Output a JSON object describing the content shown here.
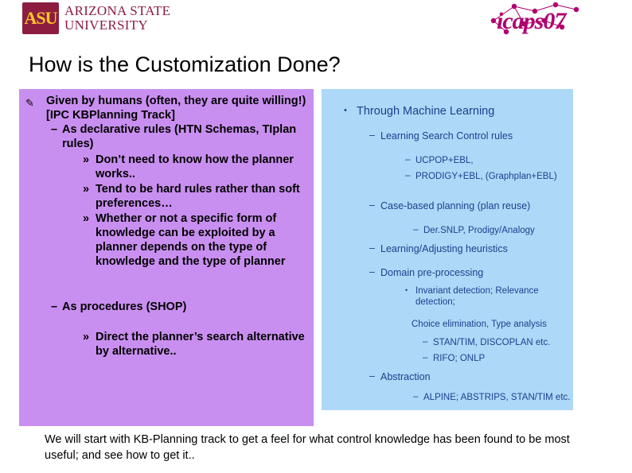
{
  "header": {
    "asu_logo": {
      "mark": "ASU",
      "line1_caps": "RIZONA",
      "line1_first": "A",
      "line1_word2_first": "S",
      "line1_word2_caps": "TATE",
      "line1": "ARIZONA STATE",
      "line2": "UNIVERSITY"
    },
    "icaps_logo_text": "icaps07"
  },
  "title": "How is the Customization Done?",
  "left_panel": {
    "level1": "Given by humans (often, they are quite willing!)[IPC KBPlanning Track]",
    "items": [
      {
        "level": 2,
        "text": "As declarative rules (HTN Schemas, TIplan rules)"
      },
      {
        "level": 3,
        "text": "Don’t need to know how the planner works.."
      },
      {
        "level": 3,
        "text": "Tend to be hard rules rather than soft preferences…"
      },
      {
        "level": 3,
        "text": "Whether or not a specific form of knowledge can be exploited by a planner depends on the type of knowledge and the type of planner"
      },
      {
        "level": 2,
        "text": "As procedures (SHOP)"
      },
      {
        "level": 3,
        "text": "Direct the planner’s search alternative by alternative.."
      }
    ]
  },
  "right_panel": {
    "level1": "Through Machine Learning",
    "items": [
      {
        "level": 2,
        "text": "Learning Search Control rules"
      },
      {
        "level": 3,
        "text": "UCPOP+EBL,"
      },
      {
        "level": 3,
        "text": "PRODIGY+EBL, (Graphplan+EBL)"
      },
      {
        "level": 2,
        "text": "Case-based planning (plan reuse)"
      },
      {
        "level": 3,
        "text": "Der.SNLP, Prodigy/Analogy"
      },
      {
        "level": 2,
        "text": "Learning/Adjusting heuristics"
      },
      {
        "level": 2,
        "text": "Domain pre-processing"
      },
      {
        "level": 4,
        "text": "Invariant detection; Relevance detection;"
      },
      {
        "level": 0,
        "text": "Choice elimination, Type analysis"
      },
      {
        "level": 3,
        "text": "STAN/TIM, DISCOPLAN etc."
      },
      {
        "level": 3,
        "text": "RIFO; ONLP"
      },
      {
        "level": 2,
        "text": "Abstraction"
      },
      {
        "level": 3,
        "text": "ALPINE; ABSTRIPS, STAN/TIM etc."
      }
    ]
  },
  "caption": "We will start with KB-Planning track to get a feel for what control knowledge has been found to be most useful; and see how to get it..",
  "colors": {
    "left_panel_bg": "#c98ff0",
    "right_panel_bg": "#add8f7",
    "right_text": "#1f3f8f",
    "asu_maroon": "#8c1d40",
    "asu_gold": "#ffc627",
    "icaps_pink": "#b0006e"
  }
}
